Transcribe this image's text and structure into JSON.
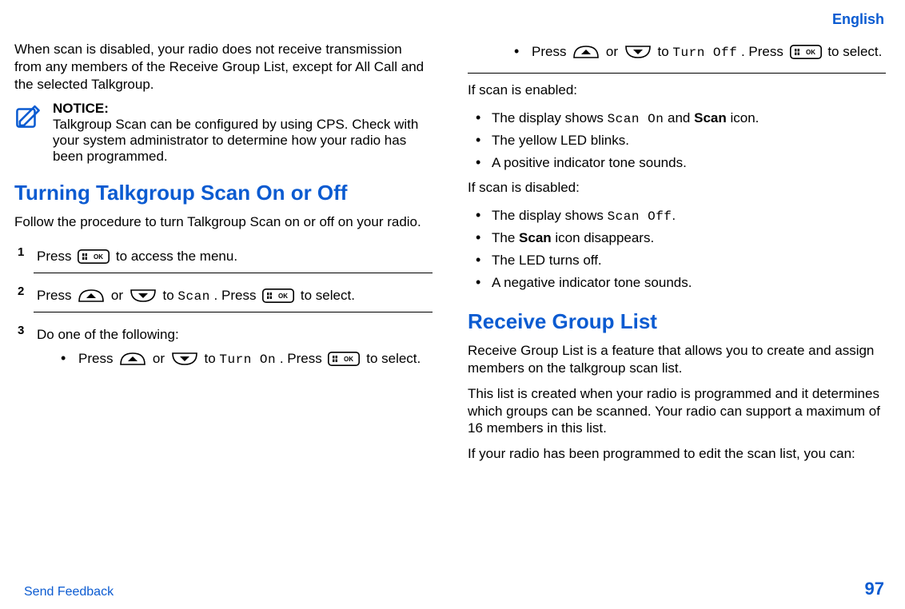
{
  "header": {
    "language": "English"
  },
  "left": {
    "intro": "When scan is disabled, your radio does not receive transmission from any members of the Receive Group List, except for All Call and the selected Talkgroup.",
    "notice": {
      "title": "NOTICE:",
      "body": "Talkgroup Scan can be configured by using CPS. Check with your system administrator to determine how your radio has been programmed."
    },
    "section_title": "Turning Talkgroup Scan On or Off",
    "section_lead": "Follow the procedure to turn Talkgroup Scan on or off on your radio.",
    "steps": {
      "s1_a": "Press ",
      "s1_b": " to access the menu.",
      "s2_a": "Press ",
      "s2_b": " or ",
      "s2_c": " to ",
      "s2_scan": "Scan",
      "s2_d": ". Press ",
      "s2_e": " to select.",
      "s3": "Do one of the following:",
      "s3_sub_a": "Press ",
      "s3_sub_b": " or ",
      "s3_sub_c": " to ",
      "s3_sub_turnon": "Turn On",
      "s3_sub_d": ". Press ",
      "s3_sub_e": " to select."
    }
  },
  "right": {
    "top_sub_a": "Press ",
    "top_sub_b": " or ",
    "top_sub_c": " to ",
    "top_sub_turnoff": "Turn Off",
    "top_sub_d": ". Press ",
    "top_sub_e": " to select.",
    "enabled_lead": "If scan is enabled:",
    "enabled": {
      "e1a": "The display shows ",
      "e1_mono": "Scan On",
      "e1b": " and ",
      "e1_bold": "Scan",
      "e1c": " icon.",
      "e2": "The yellow LED blinks.",
      "e3": "A positive indicator tone sounds."
    },
    "disabled_lead": "If scan is disabled:",
    "disabled": {
      "d1a": "The display shows ",
      "d1_mono": "Scan Off",
      "d1b": ".",
      "d2a": "The ",
      "d2_bold": "Scan",
      "d2b": " icon disappears.",
      "d3": "The LED turns off.",
      "d4": "A negative indicator tone sounds."
    },
    "rgl_title": "Receive Group List",
    "rgl_p1": "Receive Group List is a feature that allows you to create and assign members on the talkgroup scan list.",
    "rgl_p2": "This list is created when your radio is programmed and it determines which groups can be scanned. Your radio can support a maximum of 16 members in this list.",
    "rgl_p3": "If your radio has been programmed to edit the scan list, you can:"
  },
  "footer": {
    "send": "Send Feedback",
    "page": "97"
  }
}
